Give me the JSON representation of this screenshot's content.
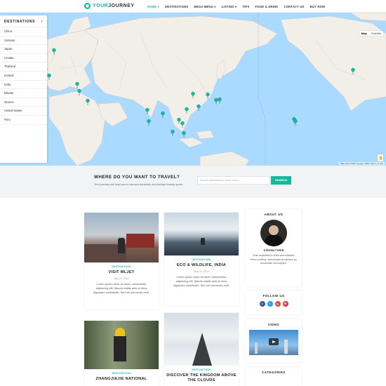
{
  "brand": {
    "name_accent": "YOUR",
    "name_rest": "JOURNEY"
  },
  "nav": [
    {
      "label": "HOME ▾",
      "active": true
    },
    {
      "label": "DESTINATIONS",
      "active": false
    },
    {
      "label": "MEGA MENU ▾",
      "active": false
    },
    {
      "label": "LISTING ▾",
      "active": false
    },
    {
      "label": "TIPS",
      "active": false
    },
    {
      "label": "FOOD & DRINK",
      "active": false
    },
    {
      "label": "CONTACT US",
      "active": false
    },
    {
      "label": "BUY NOW",
      "active": false
    }
  ],
  "map": {
    "control_map": "Map",
    "control_satellite": "Satellite",
    "credit": "Map data ©2016 Google, INEGI   Terms of Use"
  },
  "destinations": {
    "title": "DESTINATIONS",
    "items": [
      "China",
      "Vietnam",
      "Japan",
      "Croatia",
      "Thailand",
      "Iceland",
      "India",
      "Bhutan",
      "Greece",
      "United States",
      "Peru"
    ]
  },
  "search": {
    "title": "WHERE DO YOU WANT TO TRAVEL?",
    "subtitle": "Your journey will lead you to famous domestic and foreign beauty spots",
    "placeholder": "Search destinations, hotel, food ...",
    "button": "SEARCH"
  },
  "posts": [
    {
      "category": "DESTINATIONS",
      "title": "VISIT MLJET",
      "date": "May 21, 2015",
      "excerpt": "Lorem ipsum dolor sit amet, consectetur adipiscing elit. Mauris mattis ante id risus dignissim sollicitudin. Sed vel commodo velit."
    },
    {
      "category": "DESTINATIONS",
      "title": "ECO & WILDLIFE, INDIA",
      "date": "May 21, 2015",
      "excerpt": "Lorem ipsum dolor sit amet, consectetur adipiscing elit. Mauris mattis ante id risus dignissim sollicitudin. Sed vel commodo velit."
    },
    {
      "category": "DESTINATIONS",
      "title": "ZHANGJIAJIE NATIONAL",
      "date": "",
      "excerpt": ""
    },
    {
      "category": "DESTINATIONS",
      "title": "DISCOVER THE KINGDOM ABOVE THE CLOUDS",
      "date": "",
      "excerpt": ""
    }
  ],
  "about": {
    "title": "ABOUT US",
    "name": "STEVEN TYPER",
    "text": "Cras imperdiet in enim sed sodales. Proin id tellus, elementum at ultrices ac, accumsan sed sapien."
  },
  "follow": {
    "title": "FOLLOW US",
    "icons": [
      {
        "name": "facebook-icon",
        "glyph": "f",
        "color": "#3b5998"
      },
      {
        "name": "twitter-icon",
        "glyph": "t",
        "color": "#1da1f2"
      },
      {
        "name": "google-plus-icon",
        "glyph": "g",
        "color": "#dd4b39"
      },
      {
        "name": "email-icon",
        "glyph": "✉",
        "color": "#d13c54"
      }
    ]
  },
  "video": {
    "title": "VIDEO"
  },
  "categories": {
    "title": "CATEGORIES"
  },
  "colors": {
    "accent": "#16b9a0",
    "ocean": "#aadaff",
    "land": "#f2efe9"
  }
}
